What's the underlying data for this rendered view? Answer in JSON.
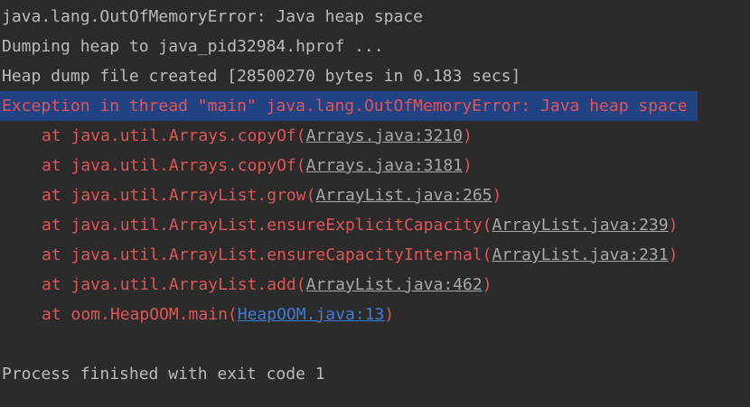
{
  "console": {
    "header_lines": [
      "java.lang.OutOfMemoryError: Java heap space",
      "Dumping heap to java_pid32984.hprof ...",
      "Heap dump file created [28500270 bytes in 0.183 secs]"
    ],
    "exception_line": "Exception in thread \"main\" java.lang.OutOfMemoryError: Java heap space",
    "frames": [
      {
        "method": "at java.util.Arrays.copyOf",
        "location": "Arrays.java:3210",
        "link_style": "library"
      },
      {
        "method": "at java.util.Arrays.copyOf",
        "location": "Arrays.java:3181",
        "link_style": "library"
      },
      {
        "method": "at java.util.ArrayList.grow",
        "location": "ArrayList.java:265",
        "link_style": "library"
      },
      {
        "method": "at java.util.ArrayList.ensureExplicitCapacity",
        "location": "ArrayList.java:239",
        "link_style": "library"
      },
      {
        "method": "at java.util.ArrayList.ensureCapacityInternal",
        "location": "ArrayList.java:231",
        "link_style": "library"
      },
      {
        "method": "at java.util.ArrayList.add",
        "location": "ArrayList.java:462",
        "link_style": "library"
      },
      {
        "method": "at oom.HeapOOM.main",
        "location": "HeapOOM.java:13",
        "link_style": "user"
      }
    ],
    "footer_line": "Process finished with exit code 1"
  },
  "colors": {
    "background": "#2b2b2b",
    "default_text": "#bbbbbb",
    "error_text": "#e05555",
    "selection": "#214283",
    "library_link": "#a8a8a8",
    "user_link": "#3d7bd6"
  }
}
